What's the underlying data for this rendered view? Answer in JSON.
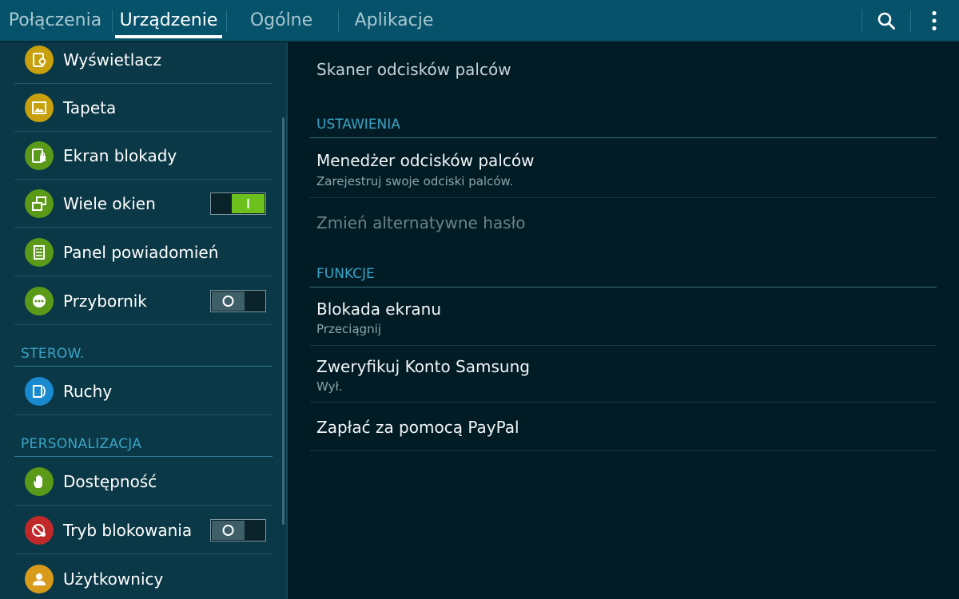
{
  "tabs": [
    {
      "label": "Połączenia",
      "active": false
    },
    {
      "label": "Urządzenie",
      "active": true
    },
    {
      "label": "Ogólne",
      "active": false
    },
    {
      "label": "Aplikacje",
      "active": false
    }
  ],
  "toolbar": {
    "search_icon": "search-icon",
    "menu_icon": "more-vert-icon"
  },
  "sidebar": {
    "items": [
      {
        "label": "Wyświetlacz",
        "icon": "display-icon",
        "color": "#c8a00c"
      },
      {
        "label": "Tapeta",
        "icon": "wallpaper-icon",
        "color": "#c8a00c"
      },
      {
        "label": "Ekran blokady",
        "icon": "lock-screen-icon",
        "color": "#5a9a18"
      },
      {
        "label": "Wiele okien",
        "icon": "multi-window-icon",
        "color": "#5a9a18",
        "toggle": "on"
      },
      {
        "label": "Panel powiadomień",
        "icon": "notification-panel-icon",
        "color": "#5a9a18"
      },
      {
        "label": "Przybornik",
        "icon": "toolbox-icon",
        "color": "#5a9a18",
        "toggle": "off"
      }
    ],
    "section_sterow": "STEROW.",
    "sterow_items": [
      {
        "label": "Ruchy",
        "icon": "motions-icon",
        "color": "#1a8ad0"
      }
    ],
    "section_personalizacja": "PERSONALIZACJA",
    "personal_items": [
      {
        "label": "Dostępność",
        "icon": "hand-icon",
        "color": "#5a9a18"
      },
      {
        "label": "Tryb blokowania",
        "icon": "blocking-mode-icon",
        "color": "#c0282a",
        "toggle": "off"
      },
      {
        "label": "Użytkownicy",
        "icon": "users-icon",
        "color": "#d89a1a"
      }
    ]
  },
  "main": {
    "title": "Skaner odcisków palców",
    "section_settings": "USTAWIENIA",
    "settings_rows": [
      {
        "primary": "Menedżer odcisków palców",
        "secondary": "Zarejestruj swoje odciski palców."
      },
      {
        "primary": "Zmień alternatywne hasło",
        "disabled": true
      }
    ],
    "section_functions": "FUNKCJE",
    "function_rows": [
      {
        "primary": "Blokada ekranu",
        "secondary": "Przeciągnij"
      },
      {
        "primary": "Zweryfikuj Konto Samsung",
        "secondary": "Wył."
      },
      {
        "primary": "Zapłać za pomocą PayPal"
      }
    ]
  }
}
